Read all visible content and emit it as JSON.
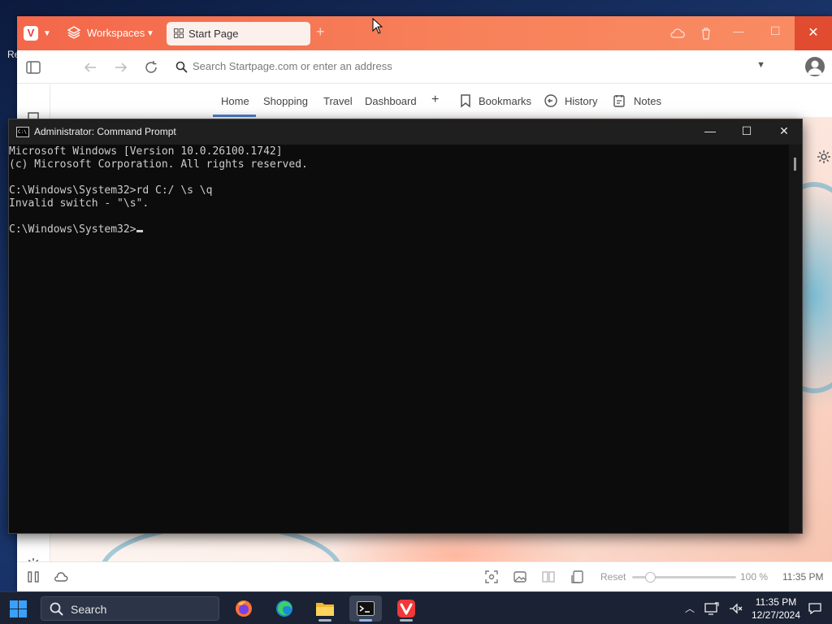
{
  "desktop": {
    "edge_fragments": [
      "Re"
    ]
  },
  "browser": {
    "workspaces_label": "Workspaces",
    "active_tab": "Start Page",
    "address_placeholder": "Search Startpage.com or enter an address",
    "startpage_nav": {
      "links": [
        "Home",
        "Shopping",
        "Travel",
        "Dashboard"
      ],
      "add": "+",
      "bookmarks": "Bookmarks",
      "history": "History",
      "notes": "Notes"
    },
    "statusbar": {
      "reset_label": "Reset",
      "zoom_percent": "100 %",
      "zoom_level": 1.0,
      "clock": "11:35 PM"
    },
    "accent_color": "#f4674a"
  },
  "cmd": {
    "title": "Administrator: Command Prompt",
    "lines": [
      "Microsoft Windows [Version 10.0.26100.1742]",
      "(c) Microsoft Corporation. All rights reserved.",
      "",
      "C:\\Windows\\System32>rd C:/ \\s \\q",
      "Invalid switch - \"\\s\".",
      "",
      "C:\\Windows\\System32>"
    ]
  },
  "taskbar": {
    "search_label": "Search",
    "apps": [
      "firefox-icon",
      "edge-icon",
      "file-explorer-icon",
      "terminal-icon",
      "vivaldi-icon"
    ],
    "time": "11:35 PM",
    "date": "12/27/2024"
  }
}
